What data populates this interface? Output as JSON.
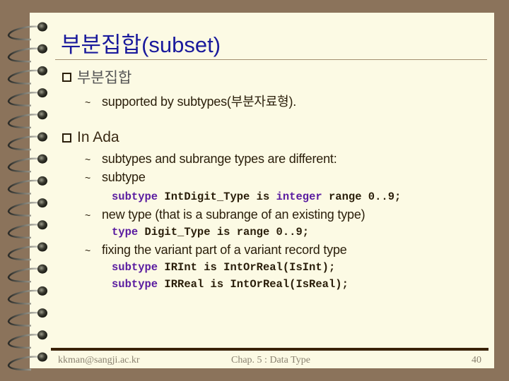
{
  "slide": {
    "title": "부분집합(subset)",
    "bullets": [
      {
        "label": "부분집합",
        "items": [
          {
            "text": "supported by subtypes(부분자료형)."
          }
        ]
      },
      {
        "label": "In Ada",
        "items": [
          {
            "text": "subtypes and subrange types are different:"
          },
          {
            "text": "subtype"
          },
          {
            "text": "new type (that is a subrange of an existing type)"
          },
          {
            "text": "fixing the variant part of a variant record type"
          }
        ]
      }
    ],
    "code": {
      "line1": {
        "kw1": "subtype",
        "mid1": " IntDigit_Type is ",
        "kw2": "integer",
        "rest": " range 0..9;"
      },
      "line2": {
        "kw1": "type",
        "rest": " Digit_Type is range 0..9;"
      },
      "line3": {
        "kw1": "subtype",
        "rest": " IRInt is IntOrReal(IsInt);"
      },
      "line4": {
        "kw1": "subtype",
        "rest": " IRReal is IntOrReal(IsReal);"
      }
    },
    "bullet_marker": "checkbox-square",
    "sub_marker": "~"
  },
  "footer": {
    "email": "kkman@sangji.ac.kr",
    "chapter": "Chap. 5 : Data Type",
    "page": "40"
  },
  "colors": {
    "background": "#8b735b",
    "paper": "#fcfae4",
    "title": "#1a1a9c",
    "keyword": "#5a1ca0",
    "text": "#2a1e0a"
  }
}
